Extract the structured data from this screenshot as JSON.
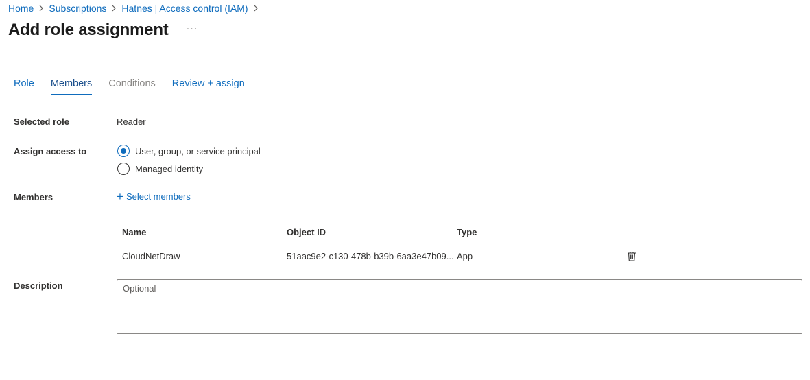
{
  "breadcrumb": [
    "Home",
    "Subscriptions",
    "Hatnes | Access control (IAM)"
  ],
  "page": {
    "title": "Add role assignment",
    "more_label": "···"
  },
  "tabs": [
    {
      "label": "Role",
      "state": "normal"
    },
    {
      "label": "Members",
      "state": "active"
    },
    {
      "label": "Conditions",
      "state": "disabled"
    },
    {
      "label": "Review + assign",
      "state": "normal"
    }
  ],
  "form": {
    "selected_role_label": "Selected role",
    "selected_role_value": "Reader",
    "assign_access_label": "Assign access to",
    "assign_options": [
      {
        "label": "User, group, or service principal",
        "checked": true
      },
      {
        "label": "Managed identity",
        "checked": false
      }
    ],
    "members_label": "Members",
    "select_members_label": "Select members",
    "description_label": "Description",
    "description_placeholder": "Optional"
  },
  "members_table": {
    "columns": [
      "Name",
      "Object ID",
      "Type"
    ],
    "rows": [
      {
        "name": "CloudNetDraw",
        "object_id": "51aac9e2-c130-478b-b39b-6aa3e47b09...",
        "type": "App"
      }
    ]
  },
  "colors": {
    "accent": "#0f6cbd"
  }
}
